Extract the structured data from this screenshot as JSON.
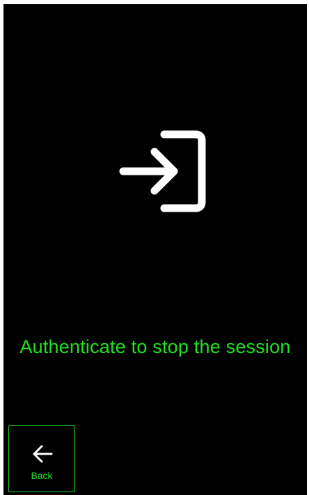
{
  "screen": {
    "icon": "login-icon",
    "message": "Authenticate to stop the session"
  },
  "back_button": {
    "icon": "arrow-left-icon",
    "label": "Back"
  },
  "colors": {
    "background": "#000000",
    "accent": "#1ee21e",
    "icon": "#ffffff"
  }
}
